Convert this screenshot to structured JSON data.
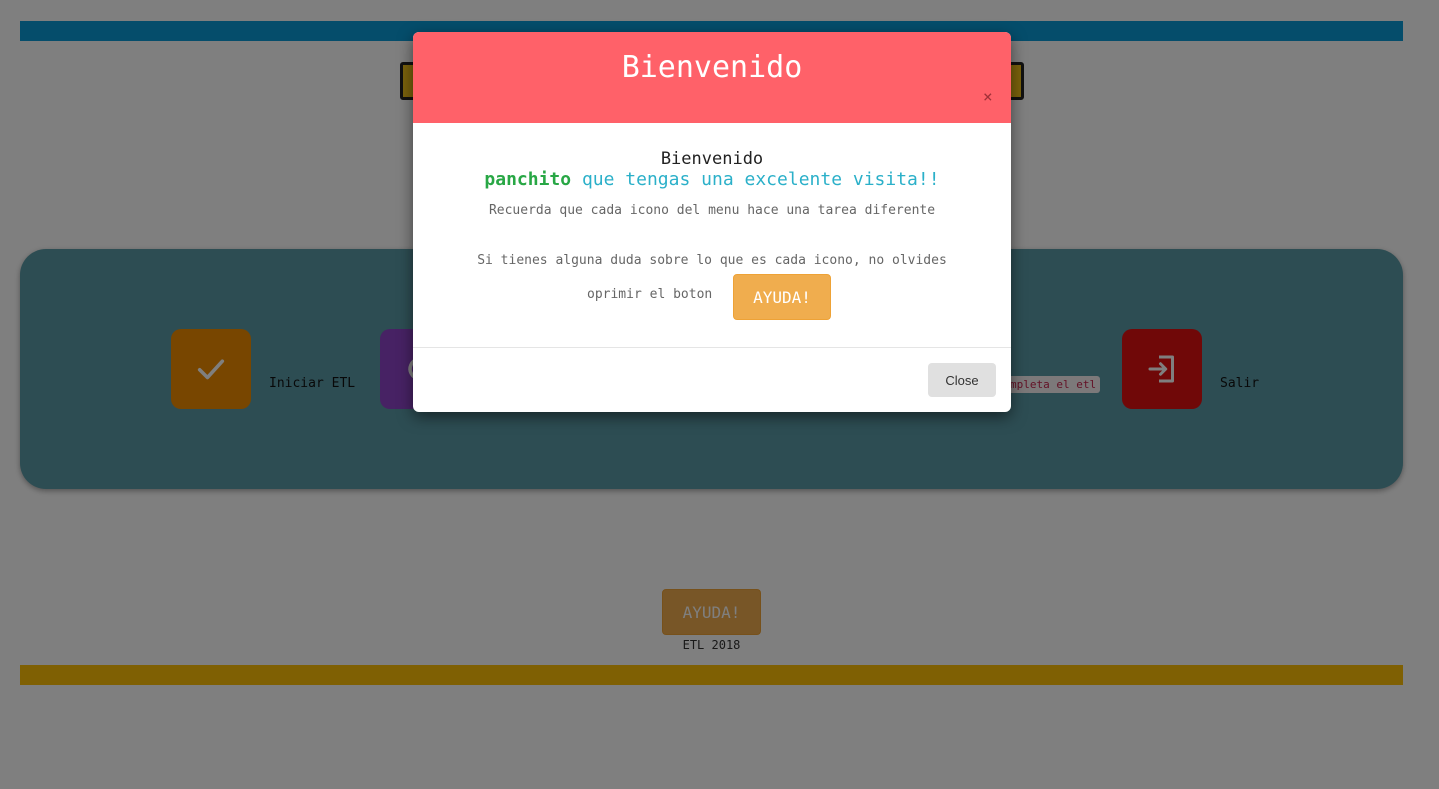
{
  "page": {
    "menu": {
      "items": [
        {
          "label": "Iniciar ETL",
          "icon": "check-icon",
          "color": "#f08c00"
        },
        {
          "label": "",
          "icon": "refresh-icon",
          "color": "#8e44c8"
        },
        {
          "label": "Salir",
          "icon": "exit-icon",
          "color": "#e01010"
        }
      ],
      "note": "mpleta el etl"
    },
    "help_button": "AYUDA!",
    "footer": "ETL 2018",
    "colors": {
      "top_bar": "#0a9bd6",
      "bottom_bar": "#ffc107",
      "panel": "#5a9aa6"
    }
  },
  "modal": {
    "title": "Bienvenido",
    "close_x": "×",
    "greeting": "Bienvenido",
    "username": "panchito",
    "welcome_rest": "que tengas una excelente visita!!",
    "note_line1": "Recuerda que cada icono del menu hace una tarea diferente",
    "note_line2": "Si tienes alguna duda sobre lo que es cada icono, no olvides",
    "note_line3": "oprimir el boton",
    "help_button": "AYUDA!",
    "close_button": "Close",
    "header_color": "#ff6169"
  }
}
